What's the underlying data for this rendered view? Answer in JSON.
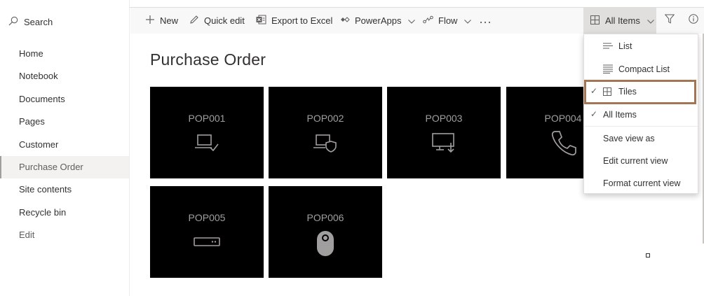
{
  "search": {
    "label": "Search"
  },
  "nav": {
    "items": [
      {
        "label": "Home"
      },
      {
        "label": "Notebook"
      },
      {
        "label": "Documents"
      },
      {
        "label": "Pages"
      },
      {
        "label": "Customer"
      },
      {
        "label": "Purchase Order",
        "selected": true
      },
      {
        "label": "Site contents"
      },
      {
        "label": "Recycle bin"
      },
      {
        "label": "Edit"
      }
    ]
  },
  "toolbar": {
    "new_label": "New",
    "quick_edit_label": "Quick edit",
    "export_label": "Export to Excel",
    "powerapps_label": "PowerApps",
    "flow_label": "Flow",
    "view_label": "All Items"
  },
  "main": {
    "title": "Purchase Order",
    "tiles": [
      {
        "label": "POP001",
        "icon": "laptop-check-icon"
      },
      {
        "label": "POP002",
        "icon": "laptop-shield-icon"
      },
      {
        "label": "POP003",
        "icon": "monitor-download-icon"
      },
      {
        "label": "POP004",
        "icon": "phone-icon"
      },
      {
        "label": "POP005",
        "icon": "router-icon"
      },
      {
        "label": "POP006",
        "icon": "mouse-icon"
      }
    ]
  },
  "view_menu": {
    "items": [
      {
        "label": "List",
        "icon": "list-icon"
      },
      {
        "label": "Compact List",
        "icon": "compact-list-icon"
      },
      {
        "label": "Tiles",
        "icon": "tiles-icon",
        "checked": true
      },
      {
        "label": "All Items",
        "checked": true
      },
      {
        "label": "Save view as"
      },
      {
        "label": "Edit current view"
      },
      {
        "label": "Format current view"
      }
    ]
  },
  "colors": {
    "tile_bg": "#000000",
    "tile_fg": "#a19f9d",
    "highlight_border": "#a47552",
    "cmdbar_bg": "#f8f8f8"
  }
}
